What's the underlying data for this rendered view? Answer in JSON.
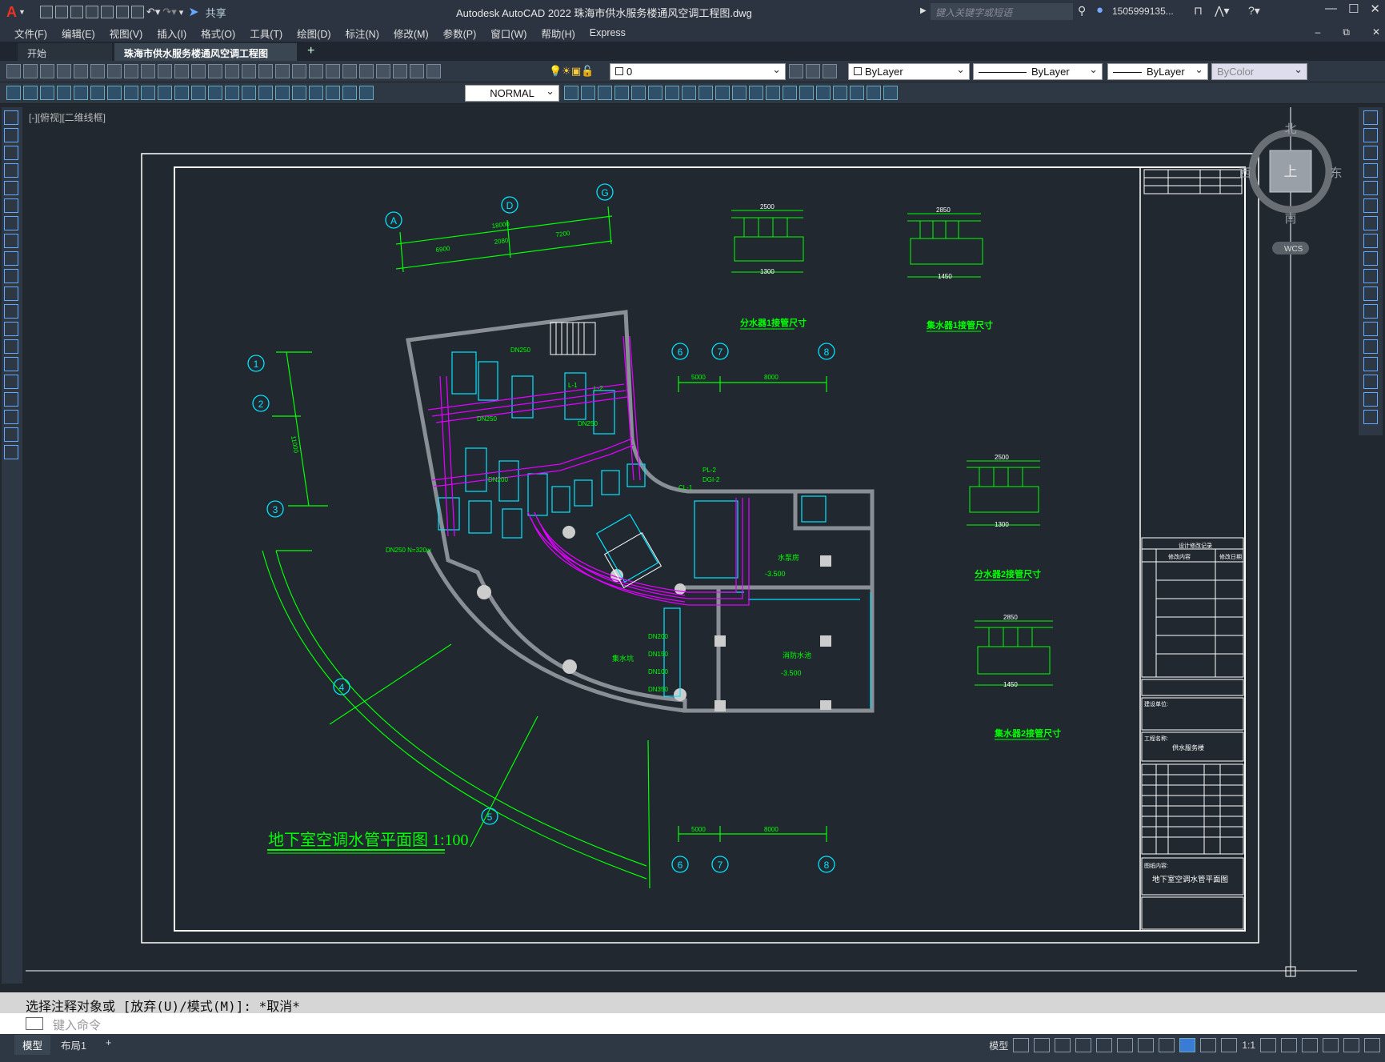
{
  "app": {
    "logo": "A",
    "share_label": "共享",
    "window_title": "Autodesk AutoCAD 2022    珠海市供水服务楼通风空调工程图.dwg",
    "search_placeholder": "键入关键字或短语",
    "user": "1505999135..."
  },
  "menu": [
    "文件(F)",
    "编辑(E)",
    "视图(V)",
    "插入(I)",
    "格式(O)",
    "工具(T)",
    "绘图(D)",
    "标注(N)",
    "修改(M)",
    "参数(P)",
    "窗口(W)",
    "帮助(H)",
    "Express"
  ],
  "tabs": {
    "start": "开始",
    "active": "珠海市供水服务楼通风空调工程图*"
  },
  "toolbar": {
    "layer": "0",
    "color": "ByLayer",
    "linetype": "ByLayer",
    "lineweight": "ByLayer",
    "plotstyle": "ByColor",
    "dimstyle": "NORMAL"
  },
  "viewport_label": "[-][俯视][二维线框]",
  "viewcube": {
    "north": "北",
    "south": "南",
    "east": "东",
    "west": "西",
    "top": "上",
    "wcs": "WCS"
  },
  "drawing": {
    "main_title": "地下室空调水管平面图 1:100",
    "detail_titles": [
      "分水器1接管尺寸",
      "集水器1接管尺寸",
      "分水器2接管尺寸",
      "集水器2接管尺寸"
    ],
    "axis_bubbles": [
      "A",
      "D",
      "G",
      "1",
      "2",
      "3",
      "4",
      "5",
      "6",
      "7",
      "8"
    ],
    "dims": {
      "d18000": "18000",
      "d6900": "6900",
      "d2080": "2080",
      "d7200": "7200",
      "d5000": "5000",
      "d8000": "8000",
      "d2500": "2500",
      "d2850": "2850",
      "d1300": "1300",
      "d1450": "1450",
      "d1000": "1000",
      "d11000": "11000"
    },
    "room_labels": [
      "水泵房",
      "消防水池",
      "集水坑"
    ],
    "elevation": "-3.500",
    "pipe_labels": [
      "DN250",
      "DN200",
      "DN150",
      "DN100",
      "DN350",
      "DN250 N=320w",
      "PL-2",
      "DGI-2",
      "L-1",
      "L-2",
      "CL-1"
    ],
    "title_block": {
      "revision_header": "设计修改记录",
      "rev_col1": "修改内容",
      "rev_col2": "修改日期",
      "construction_unit": "建设单位:",
      "project_name_label": "工程名称:",
      "project_name": "供水服务楼",
      "drawing_content_label": "图纸内容:",
      "drawing_name": "地下室空调水管平面图"
    }
  },
  "command": {
    "history": "选择注释对象或 [放弃(U)/模式(M)]: *取消*",
    "placeholder": "键入命令"
  },
  "status": {
    "model_tab": "模型",
    "layout_tab": "布局1",
    "add_tab": "+",
    "model_label": "模型",
    "scale": "1:1"
  },
  "colors": {
    "background": "#212830",
    "green": "#00ff00",
    "cyan": "#00e5ff",
    "magenta": "#e000ff",
    "wall": "#8a8f96",
    "white": "#ffffff"
  }
}
